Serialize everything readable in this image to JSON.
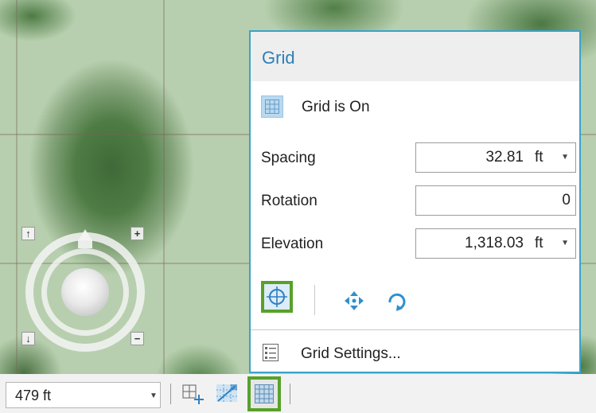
{
  "popup": {
    "title": "Grid",
    "status_label": "Grid is On",
    "spacing": {
      "label": "Spacing",
      "value": "32.81",
      "unit": "ft"
    },
    "rotation": {
      "label": "Rotation",
      "value": "0"
    },
    "elevation": {
      "label": "Elevation",
      "value": "1,318.03",
      "unit": "ft"
    },
    "tools": [
      "crosshair-snap-icon",
      "move-arrows-icon",
      "rotate-icon"
    ],
    "settings_label": "Grid Settings..."
  },
  "status_bar": {
    "scale_value": "479 ft",
    "icons": [
      "add-grid-icon",
      "snap-grid-icon",
      "grid-icon"
    ]
  },
  "navigator": {
    "buttons": [
      "arrow-up-icon",
      "plus-icon",
      "arrow-down-icon",
      "minus-icon"
    ]
  },
  "colors": {
    "accent": "#3aa3ca",
    "title_blue": "#2d7fb8",
    "highlight_green": "#57a12b"
  }
}
